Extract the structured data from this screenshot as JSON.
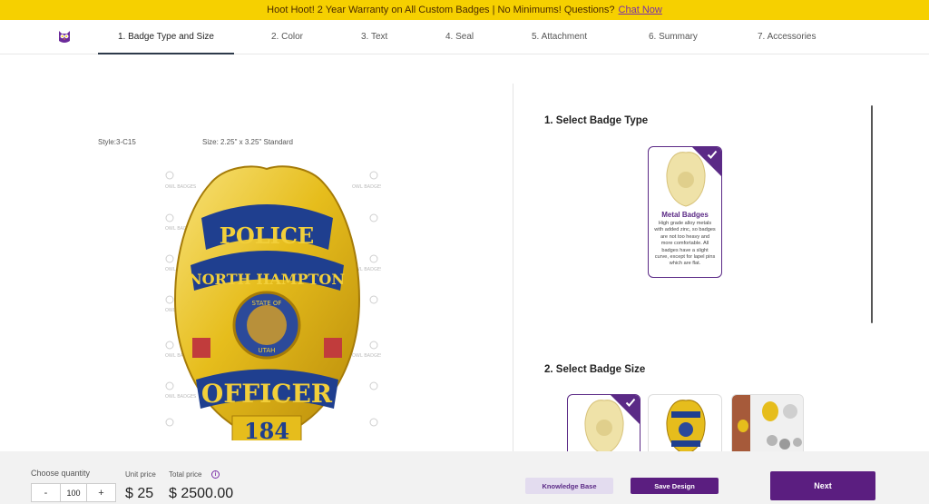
{
  "banner": {
    "text": "Hoot Hoot! 2 Year Warranty on All Custom Badges | No Minimums!  Questions?",
    "link": "Chat Now"
  },
  "nav": {
    "tabs": [
      {
        "label": "1. Badge Type and Size"
      },
      {
        "label": "2. Color"
      },
      {
        "label": "3. Text"
      },
      {
        "label": "4. Seal"
      },
      {
        "label": "5. Attachment"
      },
      {
        "label": "6. Summary"
      },
      {
        "label": "7. Accessories"
      }
    ]
  },
  "preview": {
    "style": "Style:3-C15",
    "size": "Size: 2.25\" x 3.25\" Standard",
    "watermark": "OWL BADGES",
    "badge": {
      "top": "POLICE",
      "city": "NORTH HAMPTON",
      "seal_top": "STATE OF",
      "seal_bottom": "UTAH",
      "rank": "OFFICER",
      "number": "184"
    }
  },
  "badge_type": {
    "title": "1. Select Badge Type",
    "card": {
      "title": "Metal Badges",
      "description": "High grade alloy metals with added zinc, so badges are not too heavy and more comfortable. All badges have a slight curve, except for lapel pins which are flat."
    }
  },
  "badge_size": {
    "title": "2. Select Badge Size"
  },
  "footer": {
    "quantity_label": "Choose quantity",
    "minus": "-",
    "plus": "+",
    "quantity": "100",
    "unit_label": "Unit price",
    "total_label": "Total price",
    "info": "i",
    "unit_price": "$ 25",
    "total_price": "$ 2500.00",
    "knowledge_base": "Knowledge Base",
    "save_design": "Save Design",
    "next": "Next"
  },
  "colors": {
    "banner": "#f6d000",
    "accent": "#5b1e80",
    "badge_gold": "#e8c21c",
    "badge_blue": "#1f3f8f"
  }
}
